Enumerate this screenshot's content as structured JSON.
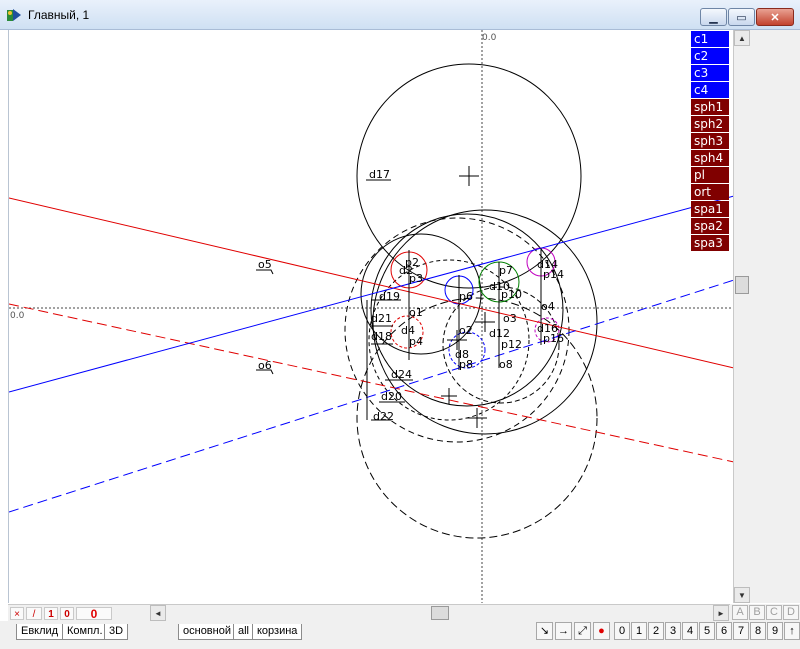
{
  "window": {
    "title": "Главный, 1",
    "buttons": {
      "minimize": "▁",
      "maximize": "▭",
      "close": "✕"
    }
  },
  "canvas": {
    "axis_x_label": "0.0",
    "axis_y_label": "0.0",
    "labels": [
      "d17",
      "d2",
      "p2",
      "p3",
      "d19",
      "o5",
      "d21",
      "o1",
      "d18",
      "d4",
      "p4",
      "o6",
      "d24",
      "d20",
      "d22",
      "o2",
      "d8",
      "p8",
      "p6",
      "p10",
      "p7",
      "d10",
      "d12",
      "o3",
      "p12",
      "o8",
      "d14",
      "p14",
      "o4",
      "d16",
      "p16"
    ]
  },
  "object_list": [
    {
      "label": "c1",
      "color": "#0000ff"
    },
    {
      "label": "c2",
      "color": "#0000ff"
    },
    {
      "label": "c3",
      "color": "#0000ff"
    },
    {
      "label": "c4",
      "color": "#0000ff"
    },
    {
      "label": "sph1",
      "color": "#800000"
    },
    {
      "label": "sph2",
      "color": "#800000"
    },
    {
      "label": "sph3",
      "color": "#800000"
    },
    {
      "label": "sph4",
      "color": "#800000"
    },
    {
      "label": "pl",
      "color": "#800000"
    },
    {
      "label": "ort",
      "color": "#800000"
    },
    {
      "label": "spa1",
      "color": "#800000"
    },
    {
      "label": "spa2",
      "color": "#800000"
    },
    {
      "label": "spa3",
      "color": "#800000"
    }
  ],
  "status": {
    "cross": "×",
    "slash": "/",
    "one": "1",
    "zero_small": "0",
    "zero_big": "0"
  },
  "scroll": {
    "left": "◄",
    "right": "►",
    "up": "▲",
    "down": "▼"
  },
  "abcd": [
    "A",
    "B",
    "C",
    "D"
  ],
  "tabs_left": [
    "Евклид",
    "Компл.",
    "3D"
  ],
  "tabs_right": [
    "основной",
    "all",
    "корзина"
  ],
  "tool_buttons": [
    "↘",
    "→",
    "⤢",
    "●"
  ],
  "number_buttons": [
    "0",
    "1",
    "2",
    "3",
    "4",
    "5",
    "6",
    "7",
    "8",
    "9",
    "↑"
  ],
  "colors": {
    "blue": "#0000ff",
    "dark_red": "#800000",
    "red": "#e00000"
  }
}
